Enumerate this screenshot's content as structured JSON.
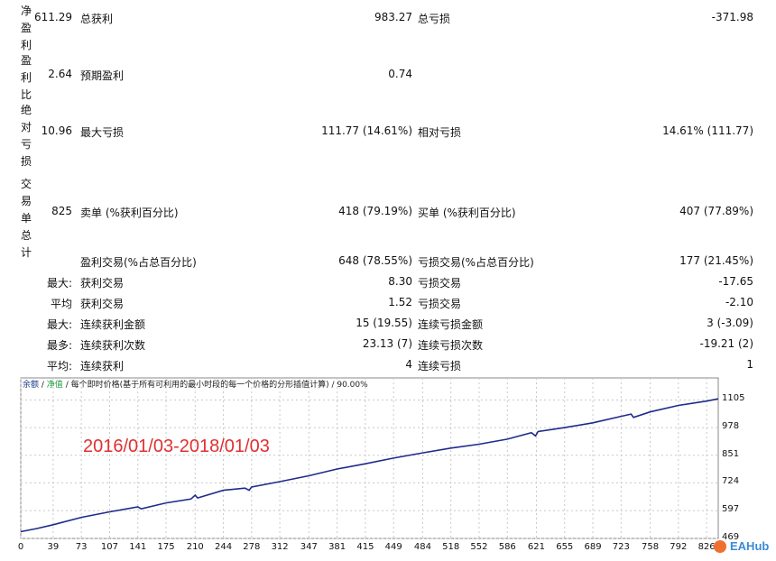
{
  "report": {
    "rows": [
      {
        "vlabel": [
          "净",
          "盈",
          "利"
        ],
        "c1": "611.29",
        "l2": "总获利",
        "v2": "983.27",
        "l3": "总亏损",
        "v3": "-371.98"
      },
      {
        "vlabel": [
          "盈",
          "利",
          "比"
        ],
        "c1": "2.64",
        "l2": "预期盈利",
        "v2": "0.74",
        "l3": "",
        "v3": ""
      },
      {
        "vlabel": [
          "绝",
          "对",
          "亏",
          "损"
        ],
        "c1": "10.96",
        "l2": "最大亏损",
        "v2": "111.77 (14.61%)",
        "l3": "相对亏损",
        "v3": "14.61% (111.77)"
      },
      {
        "vlabel": [
          "交",
          "易",
          "单",
          "总",
          "计"
        ],
        "c1": "825",
        "l2": "卖单 (%获利百分比)",
        "v2": "418 (79.19%)",
        "l3": "买单 (%获利百分比)",
        "v3": "407 (77.89%)"
      }
    ],
    "stats": [
      {
        "prefix": "",
        "l2": "盈利交易(%占总百分比)",
        "v2": "648 (78.55%)",
        "l3": "亏损交易(%占总百分比)",
        "v3": "177 (21.45%)"
      },
      {
        "prefix": "最大:",
        "l2": "获利交易",
        "v2": "8.30",
        "l3": "亏损交易",
        "v3": "-17.65"
      },
      {
        "prefix": "平均",
        "l2": "获利交易",
        "v2": "1.52",
        "l3": "亏损交易",
        "v3": "-2.10"
      },
      {
        "prefix": "最大:",
        "l2": "连续获利金额",
        "v2": "15 (19.55)",
        "l3": "连续亏损金额",
        "v3": "3 (-3.09)"
      },
      {
        "prefix": "最多:",
        "l2": "连续获利次数",
        "v2": "23.13 (7)",
        "l3": "连续亏损次数",
        "v3": "-19.21 (2)"
      },
      {
        "prefix": "平均:",
        "l2": "连续获利",
        "v2": "4",
        "l3": "连续亏损",
        "v3": "1"
      }
    ]
  },
  "chart": {
    "legend_balance": "余额",
    "legend_equity": "净值",
    "legend_rest": "/ 每个即时价格(基于所有可利用的最小时段的每一个价格的分形插值计算) / 90.00%",
    "annotation": "2016/01/03-2018/01/03",
    "watermark": "EAHub",
    "colors": {
      "line": "#1f2a8a",
      "grid": "#c8c8c8",
      "annotation": "#e03030"
    }
  },
  "chart_data": {
    "type": "line",
    "title": "",
    "xlabel": "",
    "ylabel": "",
    "xlim": [
      0,
      840
    ],
    "ylim": [
      469,
      1140
    ],
    "x_ticks": [
      0,
      39,
      73,
      107,
      141,
      175,
      210,
      244,
      278,
      312,
      347,
      381,
      415,
      449,
      484,
      518,
      552,
      586,
      621,
      655,
      689,
      723,
      758,
      792,
      826
    ],
    "x_tick_labels": [
      "0",
      "39",
      "73",
      "107",
      "141",
      "175",
      "210",
      "244",
      "278",
      "312",
      "347",
      "381",
      "415",
      "449",
      "484",
      "518",
      "552",
      "586",
      "621",
      "655",
      "689",
      "723",
      "758",
      "792",
      "826"
    ],
    "y_ticks": [
      469,
      597,
      724,
      851,
      978,
      1105
    ],
    "y_tick_labels": [
      "469",
      "597",
      "724",
      "851",
      "978",
      "1105"
    ],
    "grid": true,
    "series": [
      {
        "x": [
          0,
          20,
          39,
          73,
          107,
          141,
          145,
          175,
          205,
          210,
          213,
          244,
          270,
          275,
          278,
          312,
          347,
          381,
          415,
          449,
          484,
          518,
          552,
          586,
          615,
          620,
          623,
          655,
          689,
          723,
          735,
          738,
          758,
          792,
          826,
          840
        ],
        "values": [
          500,
          515,
          532,
          566,
          591,
          614,
          605,
          632,
          650,
          668,
          655,
          690,
          700,
          690,
          705,
          730,
          757,
          788,
          812,
          838,
          862,
          884,
          902,
          925,
          955,
          940,
          960,
          978,
          1000,
          1030,
          1040,
          1025,
          1050,
          1080,
          1100,
          1110
        ]
      }
    ]
  }
}
